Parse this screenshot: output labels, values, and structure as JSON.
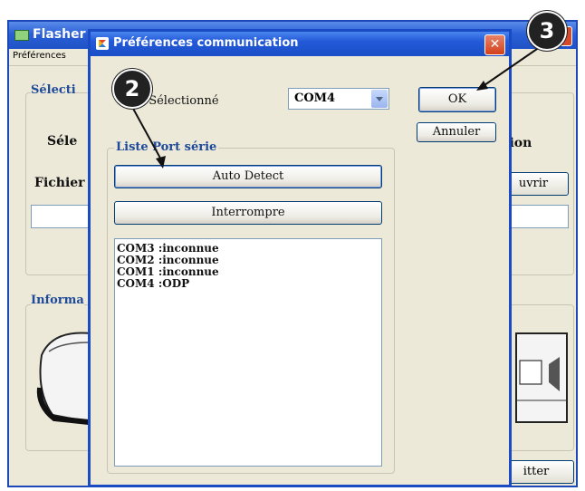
{
  "main_window": {
    "title": "Flasher",
    "menu": [
      "Préférences"
    ],
    "selection_group_label": "Sélecti",
    "selection_label": "Séle",
    "selection_suffix": "tion",
    "file_label": "Fichier",
    "open_button_partial": "uvrir",
    "info_group_label": "Informa",
    "quit_button_partial": "itter"
  },
  "dialog": {
    "title": "Préférences communication",
    "close_glyph": "✕",
    "port_label": "Port Série Sélectionné",
    "port_label_visible": "rie Sélectionné",
    "port_value": "COM4",
    "ok_label": "OK",
    "cancel_label": "Annuler",
    "port_list_group": "Liste Port série",
    "auto_detect_label": "Auto Detect",
    "stop_label": "Interrompre",
    "ports": [
      "COM3 :inconnue",
      "COM2 :inconnue",
      "COM1 :inconnue",
      "COM4 :ODP"
    ]
  },
  "callouts": {
    "two": "2",
    "three": "3"
  },
  "colors": {
    "title_bar": "#2359d8",
    "dialog_border": "#1a4bc4",
    "face": "#ece9d8",
    "group_label": "#1e4a9a",
    "close_red": "#d2401a"
  }
}
